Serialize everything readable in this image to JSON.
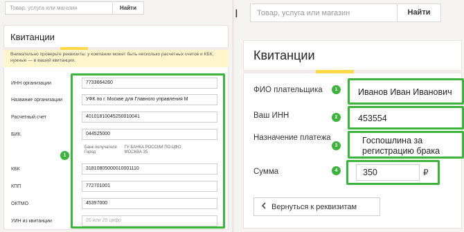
{
  "left": {
    "search": {
      "placeholder": "Товар, услуга или магазин",
      "button": "Найти"
    },
    "title": "Квитанции",
    "warning": "Внимательно проверьте реквизиты: у компании может быть несколько расчетных счетов и КБК, нужные — в вашей квитанции.",
    "fields": [
      {
        "label": "ИНН организации",
        "value": "7733664260"
      },
      {
        "label": "Название организации",
        "value": "УФК по г. Москве для Главного управления М"
      },
      {
        "label": "Расчетный счет",
        "value": "40101810045250010041"
      },
      {
        "label": "БИК",
        "value": "044525000"
      },
      {
        "label": "КБК",
        "value": "31810805000010001110"
      },
      {
        "label": "КПП",
        "value": "772701001"
      },
      {
        "label": "ОКТМО",
        "value": "45397000"
      },
      {
        "label": "УИН из квитанции",
        "placeholder": "20 или 25 цифр"
      }
    ],
    "bank": {
      "label_line1": "Банк получателя",
      "label_line2": "Город",
      "value_line1": "ГУ БАНКА РОССИИ ПО ЦФО",
      "value_line2": "МОСКВА 35"
    },
    "badge": "1"
  },
  "right": {
    "cursor_glyph": "I",
    "search": {
      "placeholder": "Товар, услуга или магазин",
      "button": "Найти"
    },
    "title": "Квитанции",
    "fields": [
      {
        "label": "ФИО плательщика",
        "badge": "1",
        "value": "Иванов Иван Иванович"
      },
      {
        "label": "Ваш ИНН",
        "badge": "2",
        "value": "453554"
      },
      {
        "label": "Назначение платежа",
        "badge": "3",
        "value": "Госпошлина за регистрацию брака"
      },
      {
        "label": "Сумма",
        "badge": "4",
        "value": "350"
      }
    ],
    "currency": "₽",
    "back_button": "Вернуться к реквизитам",
    "back_icon": "chevron-left-icon"
  },
  "colors": {
    "highlight_green": "#3cb33c",
    "accent_yellow": "#ffd84a",
    "warning_bg": "#fff5cc"
  }
}
